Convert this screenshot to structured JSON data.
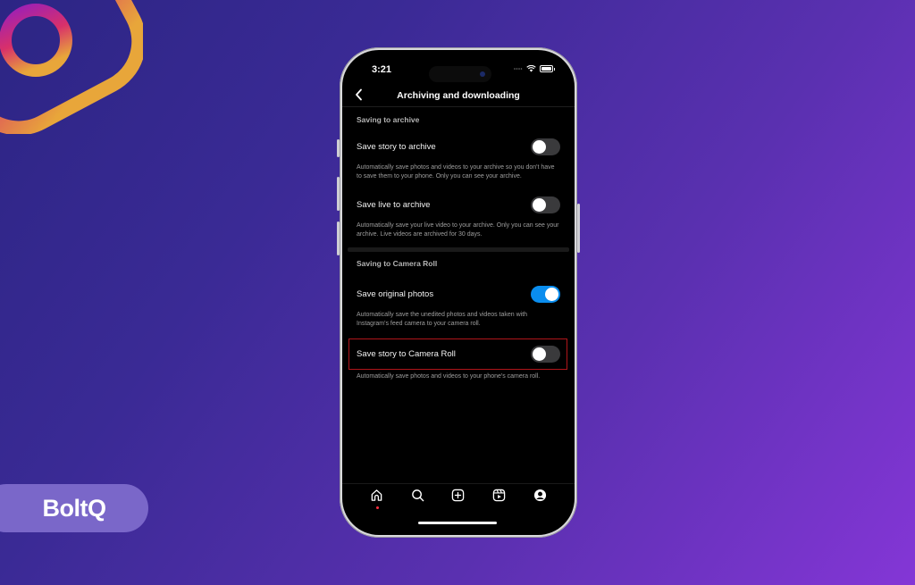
{
  "brand": {
    "name": "BoltQ"
  },
  "phone": {
    "status_bar": {
      "time": "3:21",
      "signal_icon": "signal-dots-icon",
      "wifi_icon": "wifi-icon",
      "battery_icon": "battery-icon"
    },
    "header": {
      "back_icon": "chevron-left-icon",
      "back_glyph": "‹",
      "title": "Archiving and downloading"
    },
    "sections": [
      {
        "title": "Saving to archive",
        "items": [
          {
            "label": "Save story to archive",
            "enabled": false,
            "description": "Automatically save photos and videos to your archive so you don't have to save them to your phone. Only you can see your archive."
          },
          {
            "label": "Save live to archive",
            "enabled": false,
            "description": "Automatically save your live video to your archive. Only you can see your archive. Live videos are archived for 30 days."
          }
        ]
      },
      {
        "title": "Saving to Camera Roll",
        "items": [
          {
            "label": "Save original photos",
            "enabled": true,
            "description": "Automatically save the unedited photos and videos taken with Instagram's feed camera to your camera roll."
          },
          {
            "label": "Save story to Camera Roll",
            "enabled": false,
            "highlighted": true,
            "description": "Automatically save photos and videos to your phone's camera roll."
          }
        ]
      }
    ],
    "tabbar": [
      {
        "name": "home",
        "icon": "home-icon",
        "active": true
      },
      {
        "name": "search",
        "icon": "search-icon"
      },
      {
        "name": "create",
        "icon": "plus-square-icon"
      },
      {
        "name": "reels",
        "icon": "reels-icon"
      },
      {
        "name": "profile",
        "icon": "profile-icon"
      }
    ],
    "colors": {
      "toggle_on": "#0a8dee",
      "toggle_off": "#3a3a3c",
      "highlight_border": "#b0151a",
      "notification_dot": "#ff3040"
    }
  }
}
